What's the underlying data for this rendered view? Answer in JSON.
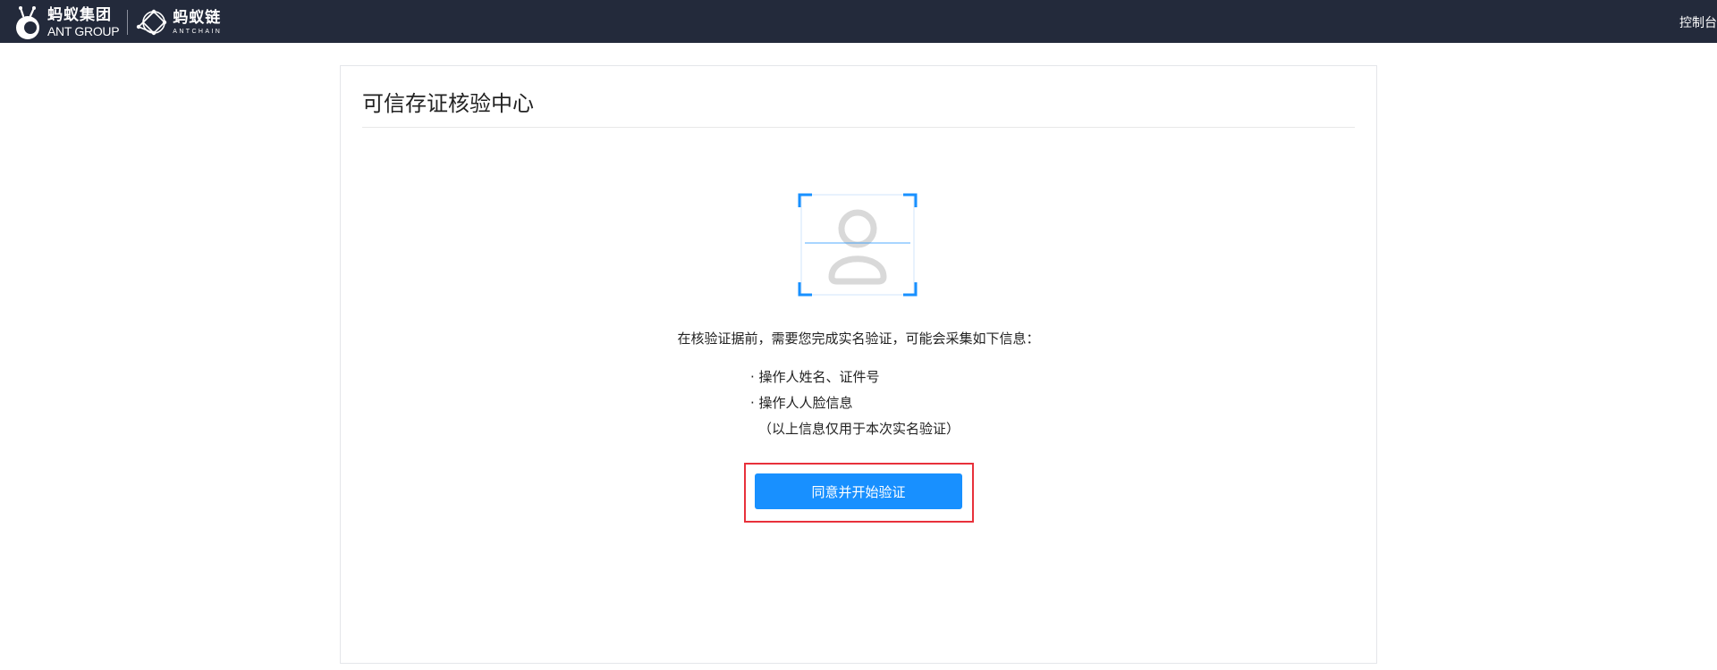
{
  "header": {
    "ant_group_cn": "蚂蚁集团",
    "ant_group_en": "ANT GROUP",
    "antchain_cn": "蚂蚁链",
    "antchain_en": "ANTCHAIN",
    "console_link": "控制台"
  },
  "card": {
    "title": "可信存证核验中心",
    "intro": "在核验证据前，需要您完成实名验证，可能会采集如下信息：",
    "items": [
      "· 操作人姓名、证件号",
      "· 操作人人脸信息"
    ],
    "note": "（以上信息仅用于本次实名验证）",
    "start_button": "同意并开始验证"
  },
  "colors": {
    "topbar": "#232a3b",
    "accent": "#1890ff",
    "highlight": "#e8313b"
  },
  "icons": {
    "ant_logo": "ant-icon",
    "antchain_logo": "antchain-icon",
    "face_scan": "face-scan-icon"
  }
}
